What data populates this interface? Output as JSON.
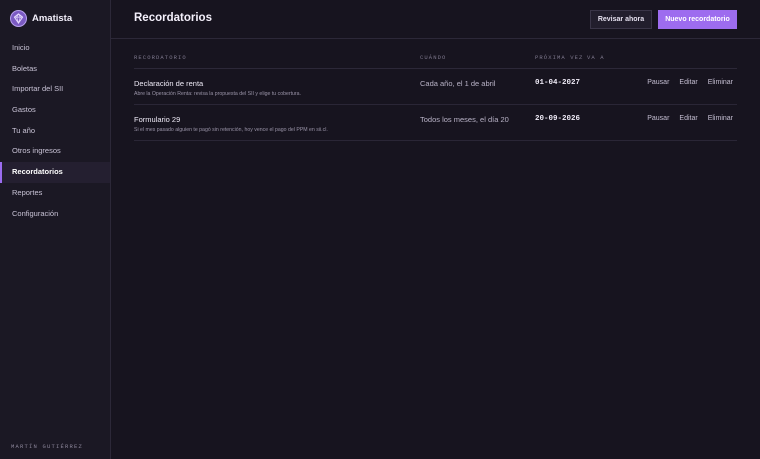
{
  "app": {
    "name": "Amatista",
    "logo_icon": "gem-icon",
    "accent": "#9d6cef"
  },
  "sidebar": {
    "items": [
      {
        "label": "Inicio"
      },
      {
        "label": "Boletas"
      },
      {
        "label": "Importar del SII"
      },
      {
        "label": "Gastos"
      },
      {
        "label": "Tu año"
      },
      {
        "label": "Otros ingresos"
      },
      {
        "label": "Recordatorios",
        "active": true
      },
      {
        "label": "Reportes"
      },
      {
        "label": "Configuración"
      }
    ],
    "user": "MARTÍN GUTIÉRREZ"
  },
  "header": {
    "title": "Recordatorios",
    "review_label": "Revisar ahora",
    "new_label": "Nuevo recordatorio"
  },
  "table": {
    "columns": {
      "reminder": "RECORDATORIO",
      "when": "CUÁNDO",
      "next": "PRÓXIMA VEZ",
      "goes": "VA A"
    },
    "rows": [
      {
        "name": "Declaración de renta",
        "description": "Abre la Operación Renta: revisa la propuesta del SII y elige tu cobertura.",
        "when": "Cada año, el 1 de abril",
        "next": "01-04-2027",
        "actions": {
          "pause": "Pausar",
          "edit": "Editar",
          "delete": "Eliminar"
        }
      },
      {
        "name": "Formulario 29",
        "description": "Si el mes pasado alguien te pagó sin retención, hoy vence el pago del PPM en sii.cl.",
        "when": "Todos los meses, el día 20",
        "next": "20-09-2026",
        "actions": {
          "pause": "Pausar",
          "edit": "Editar",
          "delete": "Eliminar"
        }
      }
    ]
  }
}
